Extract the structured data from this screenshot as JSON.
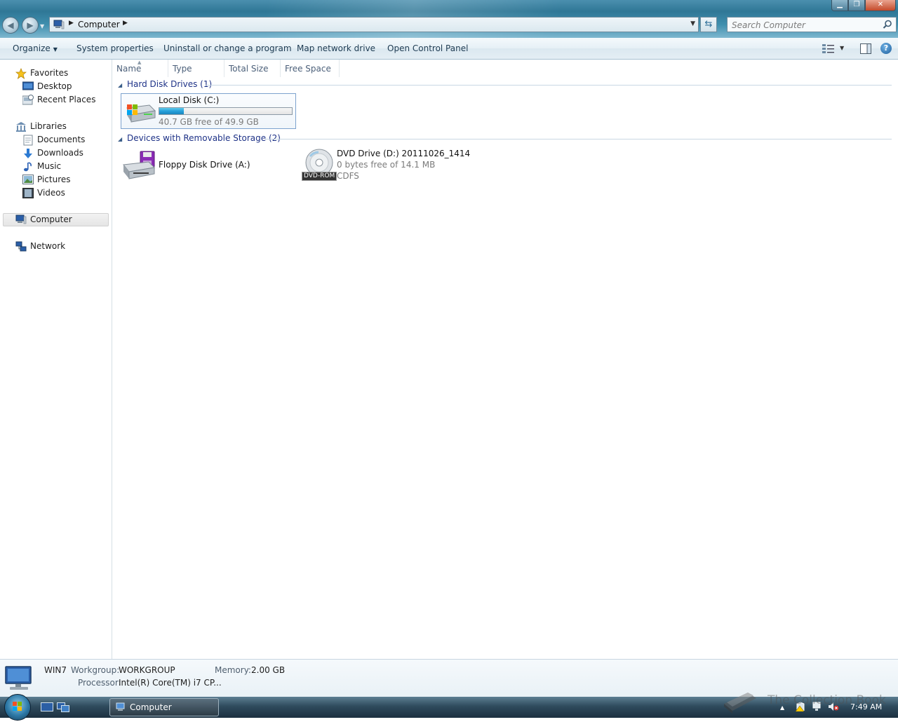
{
  "window": {
    "address_crumb": "Computer",
    "search_placeholder": "Search Computer"
  },
  "toolbar": {
    "organize": "Organize",
    "system_properties": "System properties",
    "uninstall": "Uninstall or change a program",
    "map_drive": "Map network drive",
    "control_panel": "Open Control Panel"
  },
  "nav": {
    "favorites": "Favorites",
    "desktop": "Desktop",
    "recent_places": "Recent Places",
    "libraries": "Libraries",
    "documents": "Documents",
    "downloads": "Downloads",
    "music": "Music",
    "pictures": "Pictures",
    "videos": "Videos",
    "computer": "Computer",
    "network": "Network"
  },
  "columns": [
    "Name",
    "Type",
    "Total Size",
    "Free Space"
  ],
  "groups": {
    "hard_disks": {
      "title": "Hard Disk Drives (1)",
      "items": [
        {
          "name": "Local Disk (C:)",
          "free_text": "40.7 GB free of 49.9 GB",
          "used_fraction": 0.184
        }
      ]
    },
    "removable": {
      "title": "Devices with Removable Storage (2)",
      "items": [
        {
          "name": "Floppy Disk Drive (A:)"
        },
        {
          "name": "DVD Drive (D:) 20111026_1414",
          "free_text": "0 bytes free of 14.1 MB",
          "fs": "CDFS",
          "badge": "DVD-ROM"
        }
      ]
    }
  },
  "details": {
    "computer_name": "WIN7",
    "workgroup_label": "Workgroup:",
    "workgroup": "WORKGROUP",
    "memory_label": "Memory:",
    "memory": "2.00 GB",
    "processor_label": "Processor:",
    "processor": "Intel(R) Core(TM) i7 CP..."
  },
  "taskbar": {
    "task_label": "Computer",
    "clock": "7:49 AM"
  },
  "watermark": "The Collection Book",
  "colors": {
    "accent": "#1e3287",
    "progress": "#26a0da"
  }
}
